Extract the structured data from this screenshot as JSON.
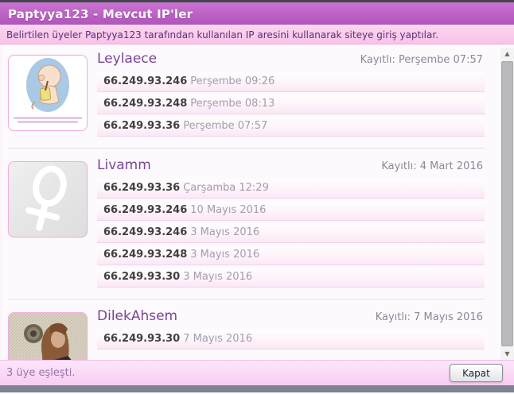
{
  "header": {
    "title": "Paptyya123 - Mevcut IP'ler"
  },
  "description": "Belirtilen üyeler Paptyya123 tarafından kullanılan IP aresini kullanarak siteye giriş yaptılar.",
  "users": [
    {
      "name": "Leylaece",
      "registered": "Kayıtlı: Perşembe 07:57",
      "avatar": "baby-cartoon",
      "ips": [
        {
          "ip": "66.249.93.246",
          "date": "Perşembe 09:26"
        },
        {
          "ip": "66.249.93.248",
          "date": "Perşembe 08:13"
        },
        {
          "ip": "66.249.93.36",
          "date": "Perşembe 07:57"
        }
      ]
    },
    {
      "name": "Livamm",
      "registered": "Kayıtlı: 4 Mart 2016",
      "avatar": "female-symbol",
      "ips": [
        {
          "ip": "66.249.93.36",
          "date": "Çarşamba 12:29"
        },
        {
          "ip": "66.249.93.246",
          "date": "10 Mayıs 2016"
        },
        {
          "ip": "66.249.93.246",
          "date": "3 Mayıs 2016"
        },
        {
          "ip": "66.249.93.248",
          "date": "3 Mayıs 2016"
        },
        {
          "ip": "66.249.93.30",
          "date": "3 Mayıs 2016"
        }
      ]
    },
    {
      "name": "DilekAhsem",
      "registered": "Kayıtlı: 7 Mayıs 2016",
      "avatar": "woman-portrait",
      "ips": [
        {
          "ip": "66.249.93.30",
          "date": "7 Mayıs 2016"
        }
      ]
    }
  ],
  "scrollbar": {
    "up_icon": "▲",
    "down_icon": "▼"
  },
  "footer": {
    "status": "3 üye eşleşti.",
    "close_label": "Kapat"
  },
  "colors": {
    "titlebar": "#bd5ec6",
    "description_bar": "#f9c8e9",
    "description_text": "#5f2d7a",
    "username": "#7b4596",
    "row_border": "#f2d5ec",
    "footer_bg": "#fad9f6",
    "bottom_bar": "#7d8593"
  }
}
